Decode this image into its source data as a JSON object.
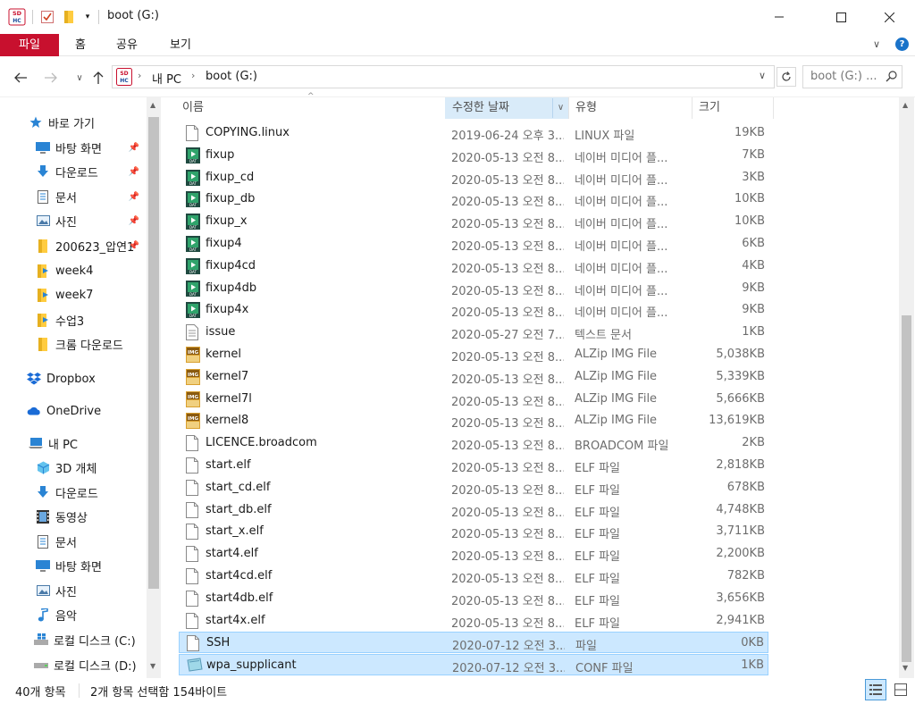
{
  "window": {
    "title": "boot (G:)",
    "app_logo": "SD\nHC"
  },
  "ribbon": {
    "tabs": [
      "파일",
      "홈",
      "공유",
      "보기"
    ]
  },
  "address": {
    "path": [
      "내 PC",
      "boot (G:)"
    ],
    "search_placeholder": "boot (G:) ..."
  },
  "nav": {
    "quick_access": "바로 가기",
    "items": [
      {
        "label": "바탕 화면",
        "icon": "desktop-icon",
        "pinned": true
      },
      {
        "label": "다운로드",
        "icon": "download-icon",
        "pinned": true
      },
      {
        "label": "문서",
        "icon": "document-icon",
        "pinned": true
      },
      {
        "label": "사진",
        "icon": "picture-icon",
        "pinned": true
      },
      {
        "label": "200623_압연1",
        "icon": "folder-icon",
        "pinned": true
      },
      {
        "label": "week4",
        "icon": "folder-icon",
        "pinned": false
      },
      {
        "label": "week7",
        "icon": "folder-icon",
        "pinned": false
      },
      {
        "label": "수업3",
        "icon": "folder-icon",
        "pinned": false
      },
      {
        "label": "크롬 다운로드",
        "icon": "folder-icon",
        "pinned": false
      }
    ],
    "dropbox": "Dropbox",
    "onedrive": "OneDrive",
    "thispc": "내 PC",
    "pc_items": [
      {
        "label": "3D 개체",
        "icon": "cube-icon"
      },
      {
        "label": "다운로드",
        "icon": "download-icon"
      },
      {
        "label": "동영상",
        "icon": "video-icon"
      },
      {
        "label": "문서",
        "icon": "document-icon"
      },
      {
        "label": "바탕 화면",
        "icon": "desktop-icon"
      },
      {
        "label": "사진",
        "icon": "picture-icon"
      },
      {
        "label": "음악",
        "icon": "music-icon"
      },
      {
        "label": "로컬 디스크 (C:)",
        "icon": "drive-icon"
      },
      {
        "label": "로컬 디스크 (D:)",
        "icon": "drive-icon"
      }
    ]
  },
  "columns": {
    "name": "이름",
    "date": "수정한 날짜",
    "type": "유형",
    "size": "크기"
  },
  "files": [
    {
      "name": "COPYING.linux",
      "date": "2019-06-24 오후 3...",
      "type": "LINUX 파일",
      "size": "19KB",
      "icon": "file-icon",
      "selected": false
    },
    {
      "name": "fixup",
      "date": "2020-05-13 오전 8...",
      "type": "네이버 미디어 플...",
      "size": "7KB",
      "icon": "media-icon",
      "selected": false
    },
    {
      "name": "fixup_cd",
      "date": "2020-05-13 오전 8...",
      "type": "네이버 미디어 플...",
      "size": "3KB",
      "icon": "media-icon",
      "selected": false
    },
    {
      "name": "fixup_db",
      "date": "2020-05-13 오전 8...",
      "type": "네이버 미디어 플...",
      "size": "10KB",
      "icon": "media-icon",
      "selected": false
    },
    {
      "name": "fixup_x",
      "date": "2020-05-13 오전 8...",
      "type": "네이버 미디어 플...",
      "size": "10KB",
      "icon": "media-icon",
      "selected": false
    },
    {
      "name": "fixup4",
      "date": "2020-05-13 오전 8...",
      "type": "네이버 미디어 플...",
      "size": "6KB",
      "icon": "media-icon",
      "selected": false
    },
    {
      "name": "fixup4cd",
      "date": "2020-05-13 오전 8...",
      "type": "네이버 미디어 플...",
      "size": "4KB",
      "icon": "media-icon",
      "selected": false
    },
    {
      "name": "fixup4db",
      "date": "2020-05-13 오전 8...",
      "type": "네이버 미디어 플...",
      "size": "9KB",
      "icon": "media-icon",
      "selected": false
    },
    {
      "name": "fixup4x",
      "date": "2020-05-13 오전 8...",
      "type": "네이버 미디어 플...",
      "size": "9KB",
      "icon": "media-icon",
      "selected": false
    },
    {
      "name": "issue",
      "date": "2020-05-27 오전 7...",
      "type": "텍스트 문서",
      "size": "1KB",
      "icon": "text-file-icon",
      "selected": false
    },
    {
      "name": "kernel",
      "date": "2020-05-13 오전 8...",
      "type": "ALZip IMG File",
      "size": "5,038KB",
      "icon": "img-icon",
      "selected": false
    },
    {
      "name": "kernel7",
      "date": "2020-05-13 오전 8...",
      "type": "ALZip IMG File",
      "size": "5,339KB",
      "icon": "img-icon",
      "selected": false
    },
    {
      "name": "kernel7l",
      "date": "2020-05-13 오전 8...",
      "type": "ALZip IMG File",
      "size": "5,666KB",
      "icon": "img-icon",
      "selected": false
    },
    {
      "name": "kernel8",
      "date": "2020-05-13 오전 8...",
      "type": "ALZip IMG File",
      "size": "13,619KB",
      "icon": "img-icon",
      "selected": false
    },
    {
      "name": "LICENCE.broadcom",
      "date": "2020-05-13 오전 8...",
      "type": "BROADCOM 파일",
      "size": "2KB",
      "icon": "file-icon",
      "selected": false
    },
    {
      "name": "start.elf",
      "date": "2020-05-13 오전 8...",
      "type": "ELF 파일",
      "size": "2,818KB",
      "icon": "file-icon",
      "selected": false
    },
    {
      "name": "start_cd.elf",
      "date": "2020-05-13 오전 8...",
      "type": "ELF 파일",
      "size": "678KB",
      "icon": "file-icon",
      "selected": false
    },
    {
      "name": "start_db.elf",
      "date": "2020-05-13 오전 8...",
      "type": "ELF 파일",
      "size": "4,748KB",
      "icon": "file-icon",
      "selected": false
    },
    {
      "name": "start_x.elf",
      "date": "2020-05-13 오전 8...",
      "type": "ELF 파일",
      "size": "3,711KB",
      "icon": "file-icon",
      "selected": false
    },
    {
      "name": "start4.elf",
      "date": "2020-05-13 오전 8...",
      "type": "ELF 파일",
      "size": "2,200KB",
      "icon": "file-icon",
      "selected": false
    },
    {
      "name": "start4cd.elf",
      "date": "2020-05-13 오전 8...",
      "type": "ELF 파일",
      "size": "782KB",
      "icon": "file-icon",
      "selected": false
    },
    {
      "name": "start4db.elf",
      "date": "2020-05-13 오전 8...",
      "type": "ELF 파일",
      "size": "3,656KB",
      "icon": "file-icon",
      "selected": false
    },
    {
      "name": "start4x.elf",
      "date": "2020-05-13 오전 8...",
      "type": "ELF 파일",
      "size": "2,941KB",
      "icon": "file-icon",
      "selected": false
    },
    {
      "name": "SSH",
      "date": "2020-07-12 오전 3...",
      "type": "파일",
      "size": "0KB",
      "icon": "file-icon",
      "selected": true
    },
    {
      "name": "wpa_supplicant",
      "date": "2020-07-12 오전 3...",
      "type": "CONF 파일",
      "size": "1KB",
      "icon": "conf-file-icon",
      "selected": true
    }
  ],
  "status": {
    "count": "40개 항목",
    "selection": "2개 항목 선택함 154바이트"
  },
  "colors": {
    "file_tab": "#c8102e",
    "selection_bg": "#cce8ff",
    "selection_border": "#99d1ff"
  }
}
